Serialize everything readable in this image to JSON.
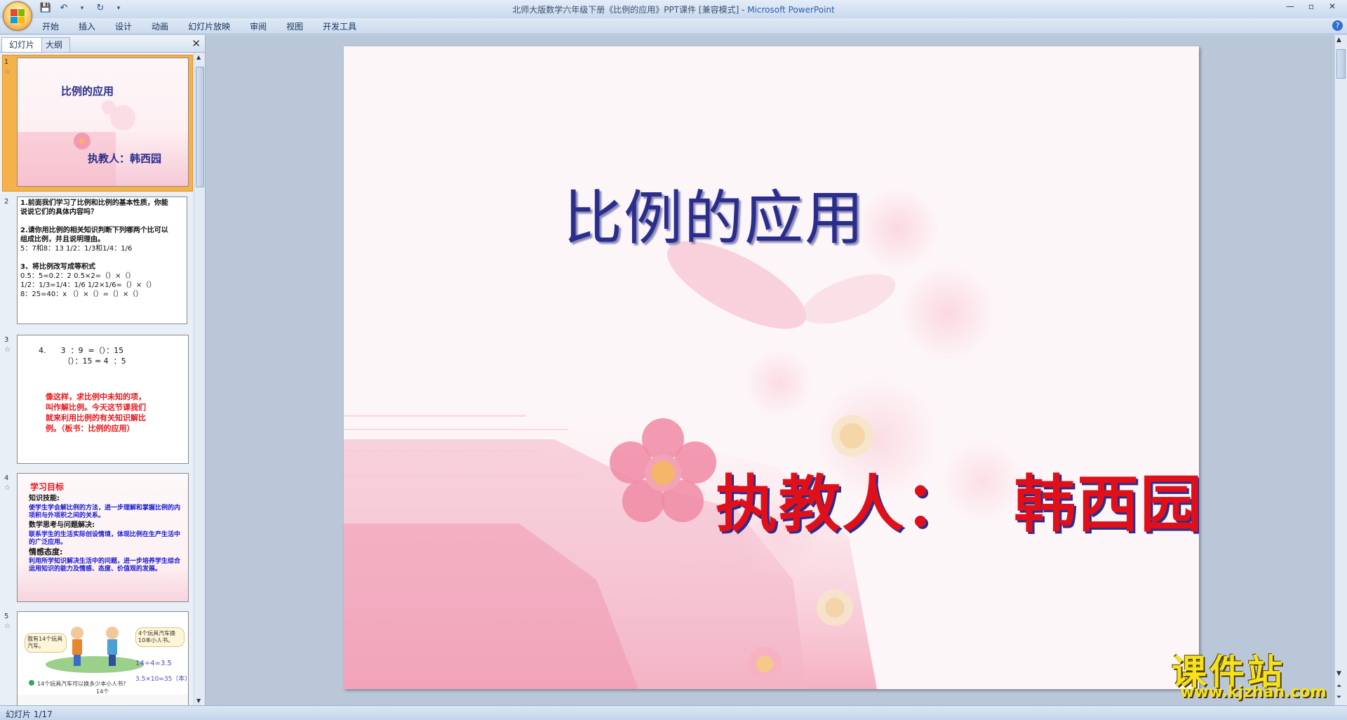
{
  "window": {
    "title": "北师大版数学六年级下册《比例的应用》PPT课件 [兼容模式] - ",
    "app_name": "Microsoft PowerPoint"
  },
  "ribbon": {
    "tabs": [
      "开始",
      "插入",
      "设计",
      "动画",
      "幻灯片放映",
      "审阅",
      "视图",
      "开发工具"
    ]
  },
  "pane": {
    "tabs": [
      "幻灯片",
      "大纲"
    ],
    "close_glyph": "✕",
    "thumbnails": [
      {
        "num": "1",
        "title": "比例的应用",
        "teacher": "执教人：韩西园"
      },
      {
        "num": "2",
        "lines": [
          "1.前面我们学习了比例和比例的基本性质，你能",
          "说说它们的具体内容吗？",
          "",
          " 2.请你用比例的相关知识判断下列哪两个比可以",
          "组成比例，并且说明理由。",
          "5：7和8：13            1/2：1/3和1/4：1/6",
          "",
          "3、将比例改写成等积式",
          "0.5：5=0.2：2         0.5×2=（）×（）",
          "1/2：1/3=1/4：1/6       1/2×1/6=（）×（）",
          "8：25=40：x           （）×（）=（）×（）"
        ]
      },
      {
        "num": "3",
        "lines": [
          "4.      3  ：9  =（）：15",
          "          （）：15 = 4  ：5"
        ],
        "red": [
          "像这样，求比例中未知的项，",
          "叫作解比例。今天这节课我们",
          "就来利用比例的有关知识解比",
          "例。（板书：比例的应用）"
        ]
      },
      {
        "num": "4",
        "heading": "学习目标",
        "sections": [
          {
            "h": "知识技能:",
            "t": "       使学生学会解比例的方法，进一步理解和掌握比例的内项积与外项积之间的关系。"
          },
          {
            "h": "数学思考与问题解决:",
            "t": "联系学生的生活实际创设情境，体现比例在生产生活中的广泛应用。"
          },
          {
            "h": "情感态度:",
            "t": "利用所学知识解决生活中的问题，进一步培养学生综合运用知识的能力及情感、态度、价值观的发展。"
          }
        ]
      },
      {
        "num": "5",
        "bubble1": "我有14个玩具汽车。",
        "bubble2": "4个玩具汽车换10本小人书。",
        "eq1": "14÷4=3.5",
        "eq2": "3.5×10=35（本）",
        "question": "14个玩具汽车可以换多少本小人书?",
        "label": "14个"
      }
    ]
  },
  "slide": {
    "title": "比例的应用",
    "teacher": "执教人：  韩西园"
  },
  "status": {
    "text": "幻灯片 1/17"
  },
  "watermark": {
    "line1": "课件站",
    "line2": "www.kjzhan.com"
  },
  "colors": {
    "title_blue": "#2a2d8c",
    "teacher_red": "#e0101a",
    "accent_orange": "#f6b24a"
  }
}
